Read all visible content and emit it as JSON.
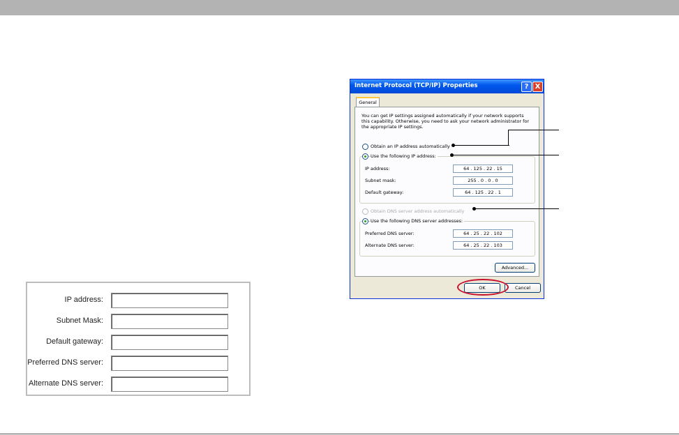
{
  "form": {
    "fields": [
      {
        "label": "IP address:"
      },
      {
        "label": "Subnet Mask:"
      },
      {
        "label": "Default gateway:"
      },
      {
        "label": "Preferred DNS server:"
      },
      {
        "label": "Alternate DNS server:"
      }
    ]
  },
  "dialog": {
    "title": "Internet Protocol (TCP/IP) Properties",
    "help_label": "?",
    "close_label": "X",
    "tab_general": "General",
    "description": "You can get IP settings assigned automatically if your network supports this capability. Otherwise, you need to ask your network administrator for the appropriate IP settings.",
    "radio_ip_auto": "Obtain an IP address automatically",
    "radio_ip_manual": "Use the following IP address:",
    "ip_address_label": "IP address:",
    "ip_address_value": "64 . 125 . 22 . 15",
    "subnet_label": "Subnet mask:",
    "subnet_value": "255 . 0 . 0 . 0",
    "gateway_label": "Default gateway:",
    "gateway_value": "64 . 125 . 22 . 1",
    "radio_dns_auto": "Obtain DNS server address automatically",
    "radio_dns_manual": "Use the following DNS server addresses:",
    "preferred_dns_label": "Preferred DNS server:",
    "preferred_dns_value": "64 . 25 . 22 . 102",
    "alternate_dns_label": "Alternate DNS server:",
    "alternate_dns_value": "64 . 25 . 22 . 103",
    "advanced_label": "Advanced...",
    "ok_label": "OK",
    "cancel_label": "Cancel"
  },
  "colors": {
    "titlebar": "#0058ee",
    "highlight_circle": "#c8102e",
    "dialog_bg": "#ece9d8"
  }
}
